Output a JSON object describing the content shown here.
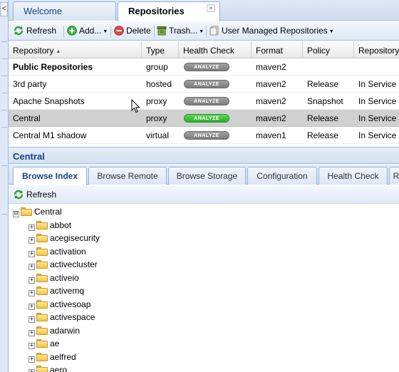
{
  "tabs": [
    {
      "label": "Welcome",
      "active": false
    },
    {
      "label": "Repositories",
      "active": true
    }
  ],
  "tab_close_glyph": "×",
  "left_collapse_glyph": "<",
  "toolbar": {
    "refresh_label": "Refresh",
    "add_label": "Add...",
    "delete_label": "Delete",
    "trash_label": "Trash...",
    "user_managed_label": "User Managed Repositories"
  },
  "grid": {
    "columns": [
      "Repository",
      "Type",
      "Health Check",
      "Format",
      "Policy",
      "Repository"
    ],
    "sort_glyph": "▲",
    "analyze_label": "ANALYZE",
    "rows": [
      {
        "name": "Public Repositories",
        "type": "group",
        "health": "off",
        "format": "maven2",
        "policy": "",
        "status": "",
        "group": true,
        "selected": false
      },
      {
        "name": "3rd party",
        "type": "hosted",
        "health": "off",
        "format": "maven2",
        "policy": "Release",
        "status": "In Service",
        "group": false,
        "selected": false
      },
      {
        "name": "Apache Snapshots",
        "type": "proxy",
        "health": "off",
        "format": "maven2",
        "policy": "Snapshot",
        "status": "In Service",
        "group": false,
        "selected": false
      },
      {
        "name": "Central",
        "type": "proxy",
        "health": "on",
        "format": "maven2",
        "policy": "Release",
        "status": "In Service",
        "group": false,
        "selected": true
      },
      {
        "name": "Central M1 shadow",
        "type": "virtual",
        "health": "off",
        "format": "maven1",
        "policy": "Release",
        "status": "In Service",
        "group": false,
        "selected": false
      }
    ]
  },
  "detail": {
    "title": "Central",
    "subtabs": [
      {
        "label": "Browse Index",
        "active": true
      },
      {
        "label": "Browse Remote",
        "active": false
      },
      {
        "label": "Browse Storage",
        "active": false
      },
      {
        "label": "Configuration",
        "active": false
      },
      {
        "label": "Health Check",
        "active": false
      },
      {
        "label": "R",
        "active": false
      }
    ],
    "refresh_label": "Refresh"
  },
  "tree": {
    "root": "Central",
    "root_toggle": "⊟",
    "child_toggle": "+",
    "children": [
      "abbot",
      "acegisecurity",
      "activation",
      "activecluster",
      "activeio",
      "activemq",
      "activesoap",
      "activespace",
      "adarwin",
      "ae",
      "aelfred",
      "aero"
    ]
  },
  "colors": {
    "accent": "#15428b",
    "selected_row": "#d0d0d0",
    "analyze_on": "#3cbf3c",
    "analyze_off": "#8a8a8a"
  },
  "icons": [
    "refresh-icon",
    "add-icon",
    "delete-icon",
    "trash-icon",
    "repositories-icon",
    "folder-icon"
  ]
}
